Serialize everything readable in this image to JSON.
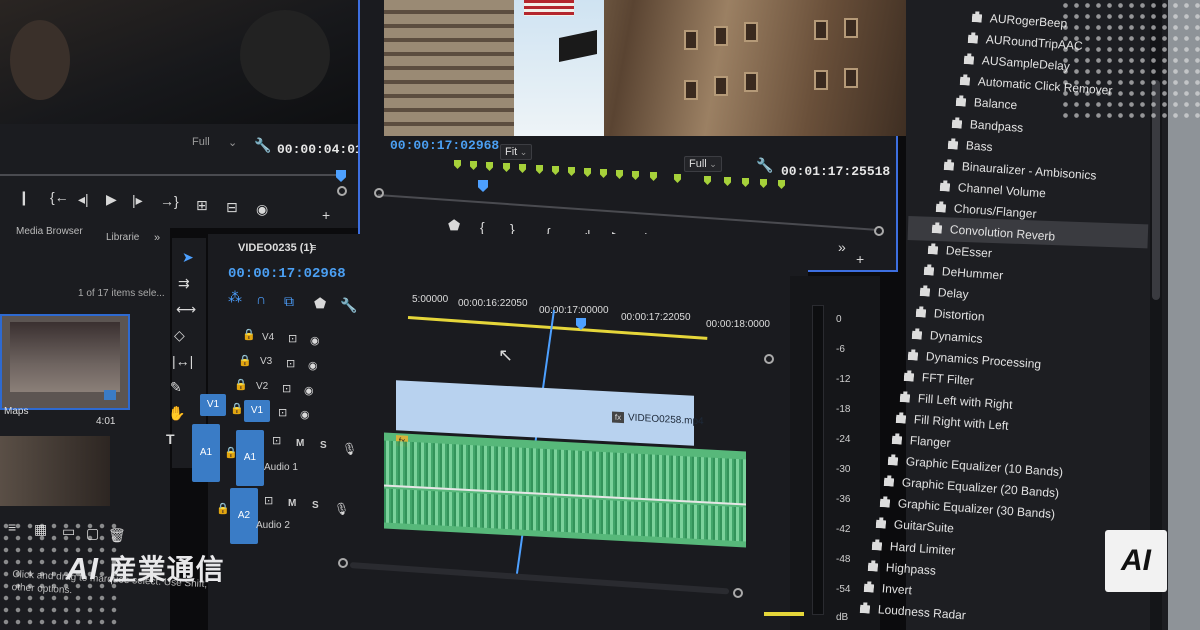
{
  "source_monitor": {
    "zoom": "Full",
    "timecode": "00:00:04:01",
    "icons": [
      "marker-icon",
      "in-point-icon",
      "out-point-icon",
      "step-back-icon",
      "play-icon",
      "step-forward-icon",
      "go-to-out-icon",
      "insert-icon",
      "overwrite-icon",
      "camera-icon",
      "add-icon"
    ]
  },
  "program_monitor": {
    "timecode": "00:00:17:02968",
    "fit": "Fit",
    "zoom": "Full",
    "duration": "00:01:17:25518"
  },
  "project_panel": {
    "tabs": [
      "Media Browser",
      "Librarie"
    ],
    "more": "»",
    "item_count": "1 of 17 items sele...",
    "thumb_label": "Maps",
    "thumb_duration": "4:01",
    "hint": "Click and drag to marquee select. Use Shift, Opt, and Cmd for other options."
  },
  "timeline": {
    "sequence_name": "VIDEO0235 (1)",
    "menu_icon": "≡",
    "timecode": "00:00:17:02968",
    "ruler": [
      "5:00000",
      "00:00:16:22050",
      "00:00:17:00000",
      "00:00:17:22050",
      "00:00:18:0000"
    ],
    "tracks": {
      "v4": "V4",
      "v3": "V3",
      "v2": "V2",
      "v1": "V1",
      "a1": "A1",
      "a2": "A2",
      "m": "M",
      "s": "S",
      "audio1": "Audio 1",
      "audio2": "Audio 2"
    },
    "video_clip": "VIDEO0258.mp4",
    "fx_badge": "fx"
  },
  "meter": {
    "scale": [
      "0",
      "-6",
      "-12",
      "-18",
      "-24",
      "-30",
      "-36",
      "-42",
      "-48",
      "-54",
      "dB"
    ]
  },
  "effects_panel": {
    "items": [
      "AURogerBeep",
      "AURoundTripAAC",
      "AUSampleDelay",
      "Automatic Click Remover",
      "Balance",
      "Bandpass",
      "Bass",
      "Binauralizer - Ambisonics",
      "Channel Volume",
      "Chorus/Flanger",
      "Convolution Reverb",
      "DeEsser",
      "DeHummer",
      "Delay",
      "Distortion",
      "Dynamics",
      "Dynamics Processing",
      "FFT Filter",
      "Fill Left with Right",
      "Fill Right with Left",
      "Flanger",
      "Graphic Equalizer (10 Bands)",
      "Graphic Equalizer (20 Bands)",
      "Graphic Equalizer (30 Bands)",
      "GuitarSuite",
      "Hard Limiter",
      "Highpass",
      "Invert",
      "Loudness Radar"
    ],
    "selected_index": 10
  },
  "branding": {
    "watermark_latin": "AI",
    "watermark_jp": "産業通信",
    "badge": "AI"
  },
  "colors": {
    "accent_blue": "#4b9ff2",
    "marker_green": "#a6d13a",
    "video_clip": "#b8d2ef",
    "audio_clip": "#57b87a",
    "work_area": "#e5d63a"
  }
}
